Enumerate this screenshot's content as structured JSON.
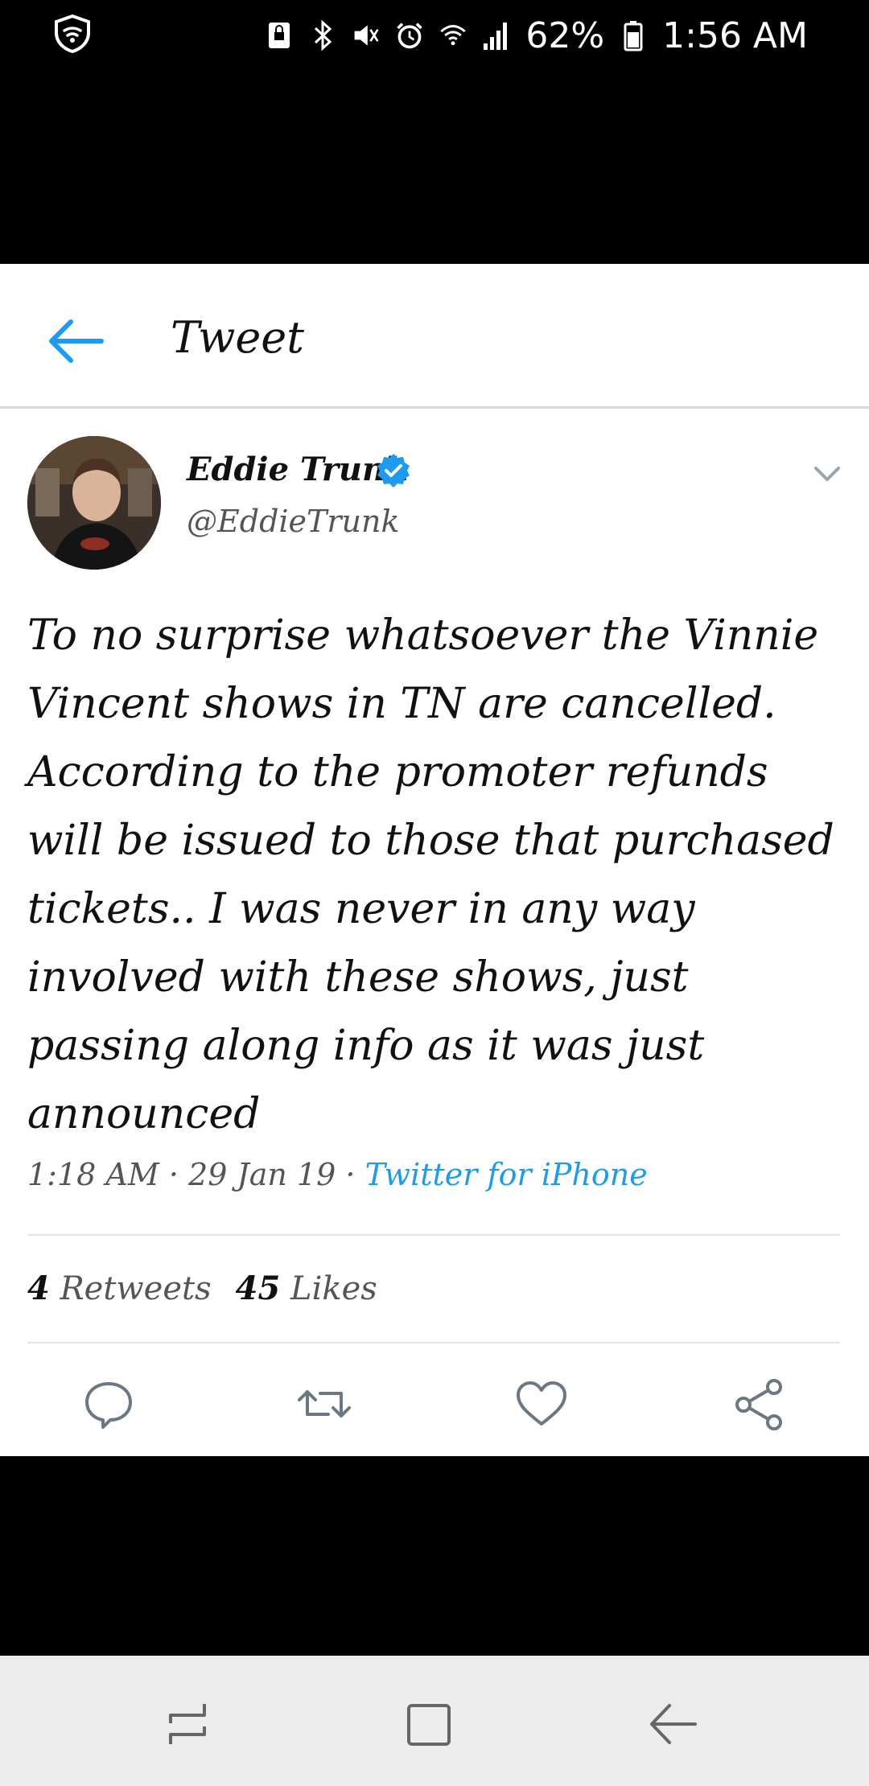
{
  "status_bar": {
    "battery": "62%",
    "time": "1:56 AM"
  },
  "header": {
    "title": "Tweet"
  },
  "tweet": {
    "author_name": "Eddie Trunk",
    "handle": "@EddieTrunk",
    "text": "To no surprise whatsoever the Vinnie Vincent shows in TN are cancelled. According to the promoter refunds will be issued to those that purchased tickets.. I was never in any way involved with these shows, just passing along info as it was just announced",
    "time": "1:18 AM",
    "separator": "·",
    "date": "29 Jan 19",
    "source": "Twitter for iPhone",
    "retweets_count": "4",
    "retweets_label": "Retweets",
    "likes_count": "45",
    "likes_label": "Likes"
  },
  "colors": {
    "accent": "#1d9bf0",
    "background": "#ffffff",
    "text": "#111111",
    "muted": "#555555"
  },
  "icons": {
    "shield": "shield-icon",
    "back": "arrow-left-icon",
    "verified": "verified-badge-icon",
    "caret": "chevron-down-icon",
    "reply": "reply-icon",
    "retweet": "retweet-icon",
    "like": "heart-icon",
    "share": "share-icon"
  }
}
